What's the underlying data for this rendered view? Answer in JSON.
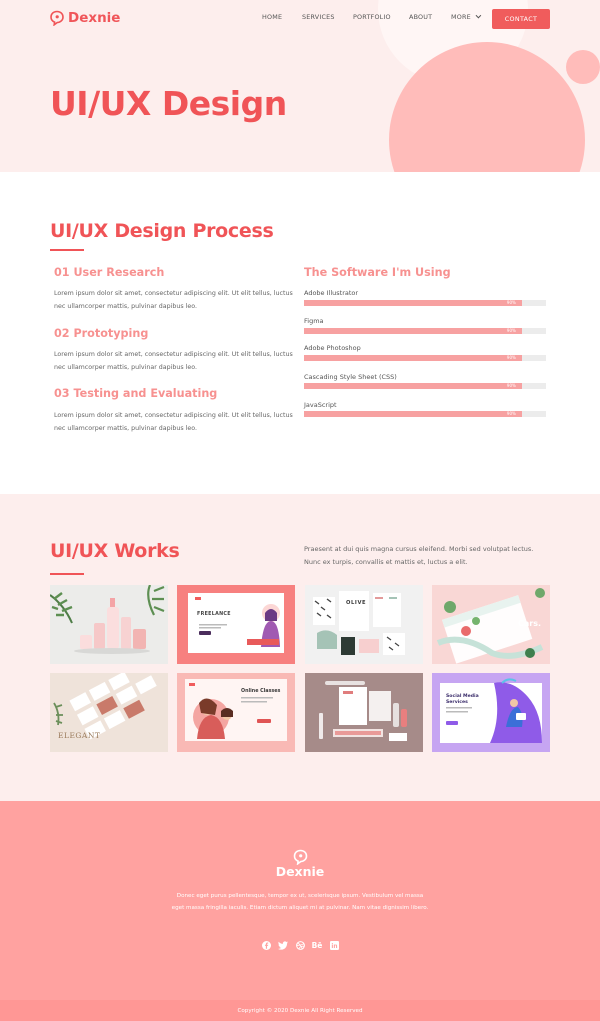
{
  "brand": {
    "name": "Dexnie",
    "accent": "#f05457",
    "icon": "chat-bubble-logo"
  },
  "nav": {
    "items": [
      "HOME",
      "SERVICES",
      "PORTFOLIO",
      "ABOUT",
      "MORE"
    ],
    "contact_label": "CONTACT"
  },
  "hero": {
    "title": "UI/UX Design"
  },
  "process": {
    "title": "UI/UX Design Process",
    "steps": [
      {
        "title": "01 User Research",
        "body": "Lorem ipsum dolor sit amet, consectetur adipiscing elit. Ut elit tellus, luctus nec ullamcorper mattis, pulvinar dapibus leo."
      },
      {
        "title": "02 Prototyping",
        "body": "Lorem ipsum dolor sit amet, consectetur adipiscing elit. Ut elit tellus, luctus nec ullamcorper mattis, pulvinar dapibus leo."
      },
      {
        "title": "03 Testing and Evaluating",
        "body": "Lorem ipsum dolor sit amet, consectetur adipiscing elit. Ut elit tellus, luctus nec ullamcorper mattis, pulvinar dapibus leo."
      }
    ],
    "skills_title": "The Software I'm Using",
    "skills": [
      {
        "label": "Adobe Illustrator",
        "percent": 90,
        "percent_label": "90%"
      },
      {
        "label": "Figma",
        "percent": 90,
        "percent_label": "90%"
      },
      {
        "label": "Adobe Photoshop",
        "percent": 90,
        "percent_label": "90%"
      },
      {
        "label": "Cascading Style Sheet (CSS)",
        "percent": 90,
        "percent_label": "90%"
      },
      {
        "label": "JavaScript",
        "percent": 90,
        "percent_label": "90%"
      }
    ]
  },
  "works": {
    "title": "UI/UX Works",
    "description": "Praesent at dui quis magna cursus eleifend. Morbi sed volutpat lectus. Nunc ex turpis, convallis et mattis et, luctus a elit.",
    "tiles": [
      {
        "name": "cosmetic-packaging"
      },
      {
        "name": "freelance-landing",
        "text": "FREELANCE"
      },
      {
        "name": "olive-identity",
        "text": "OLIVE"
      },
      {
        "name": "cars-landing",
        "text": "Cars."
      },
      {
        "name": "elegant-cards",
        "text": "ELEGANT"
      },
      {
        "name": "online-classes-landing",
        "text": "Online Classes"
      },
      {
        "name": "stationery-mockup"
      },
      {
        "name": "social-media-services",
        "text": "Social Media Services"
      }
    ]
  },
  "footer": {
    "brand": "Dexnie",
    "text": "Donec eget purus pellentesque, tempor ex ut, scelerisque ipsum. Vestibulum vel massa eget massa fringilla iaculis. Etiam dictum aliquet mi at pulvinar. Nam vitae dignissim libero.",
    "socials": [
      "facebook-icon",
      "twitter-icon",
      "dribbble-icon",
      "behance-icon",
      "linkedin-icon"
    ],
    "behance_label": "Bē",
    "linkedin_label": "in",
    "copyright": "Copyright © 2020 Dexnie All Right Reserved"
  }
}
